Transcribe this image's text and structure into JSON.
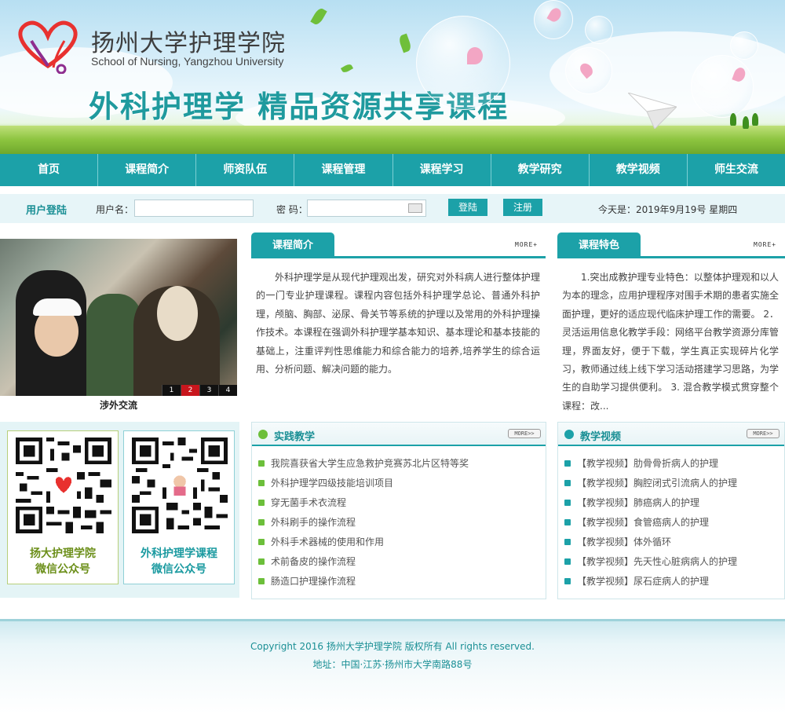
{
  "header": {
    "school_cn": "扬州大学护理学院",
    "school_en": "School of Nursing, Yangzhou University",
    "course_title": "外科护理学  精品资源共享课程"
  },
  "nav": [
    "首页",
    "课程简介",
    "师资队伍",
    "课程管理",
    "课程学习",
    "教学研究",
    "教学视频",
    "师生交流"
  ],
  "login": {
    "title": "用户登陆",
    "username_label": "用户名：",
    "password_label": "密  码：",
    "login_button": "登陆",
    "register_button": "注册",
    "today": "今天是：2019年9月19号 星期四"
  },
  "slideshow": {
    "caption": "涉外交流",
    "pages": [
      "1",
      "2",
      "3",
      "4"
    ],
    "active": "2"
  },
  "intro": {
    "tab": "课程简介",
    "more": "MORE+",
    "text": "外科护理学是从现代护理观出发，研究对外科病人进行整体护理的一门专业护理课程。课程内容包括外科护理学总论、普通外科护理，颅脑、胸部、泌尿、骨关节等系统的护理以及常用的外科护理操作技术。本课程在强调外科护理学基本知识、基本理论和基本技能的基础上，注重评判性思维能力和综合能力的培养,培养学生的综合运用、分析问题、解决问题的能力。"
  },
  "features": {
    "tab": "课程特色",
    "more": "MORE+",
    "text": "1.突出成教护理专业特色：以整体护理观和以人为本的理念，应用护理程序对围手术期的患者实施全面护理，更好的适应现代临床护理工作的需要。 2．灵活运用信息化教学手段：网络平台教学资源分库管理，界面友好，便于下载，学生真正实现碎片化学习，教师通过线上线下学习活动搭建学习思路，为学生的自助学习提供便利。 3. 混合教学模式贯穿整个课程：改..."
  },
  "qr_codes": [
    {
      "label_line1": "扬大护理学院",
      "label_line2": "微信公众号",
      "color": "#6c8f1a",
      "border": "#b7cf7a"
    },
    {
      "label_line1": "外科护理学课程",
      "label_line2": "微信公众号",
      "color": "#1a9aa0",
      "border": "#8fd0d6"
    }
  ],
  "practice": {
    "title": "实践教学",
    "more": "MORE>>",
    "dot_color": "#6cbf3a",
    "items": [
      "我院喜获省大学生应急救护竞赛苏北片区特等奖",
      "外科护理学四级技能培训项目",
      "穿无菌手术衣流程",
      "外科刷手的操作流程",
      "外科手术器械的使用和作用",
      "术前备皮的操作流程",
      "肠造口护理操作流程"
    ]
  },
  "videos": {
    "title": "教学视频",
    "more": "MORE>>",
    "dot_color": "#1ca1a8",
    "items": [
      "【教学视频】肋骨骨折病人的护理",
      "【教学视频】胸腔闭式引流病人的护理",
      "【教学视频】肺癌病人的护理",
      "【教学视频】食管癌病人的护理",
      "【教学视频】体外循环",
      "【教学视频】先天性心脏病病人的护理",
      "【教学视频】尿石症病人的护理"
    ]
  },
  "footer": {
    "copyright": "Copyright 2016 扬州大学护理学院 版权所有 All rights reserved.",
    "address": "地址：中国·江苏·扬州市大学南路88号"
  },
  "colors": {
    "accent": "#1ca1a8",
    "accent_dark": "#1a8f95",
    "active_slide": "#c8161d"
  }
}
